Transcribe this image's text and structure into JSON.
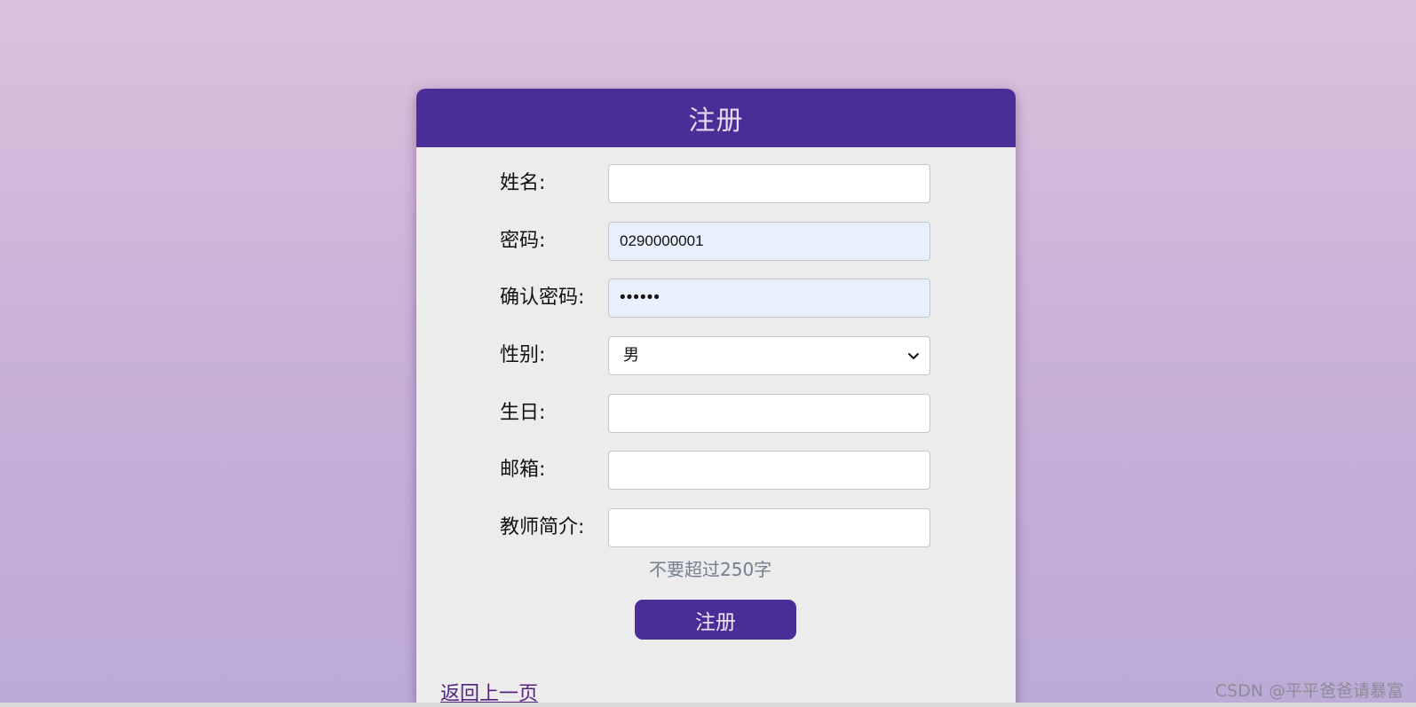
{
  "form": {
    "title": "注册",
    "fields": {
      "name": {
        "label": "姓名:",
        "value": ""
      },
      "password": {
        "label": "密码:",
        "value": "0290000001"
      },
      "confirm_password": {
        "label": "确认密码:",
        "value": "••••••"
      },
      "gender": {
        "label": "性别:",
        "value": "男"
      },
      "birthday": {
        "label": "生日:",
        "value": ""
      },
      "email": {
        "label": "邮箱:",
        "value": ""
      },
      "intro": {
        "label": "教师简介:",
        "value": ""
      }
    },
    "intro_hint": "不要超过250字",
    "submit_label": "注册",
    "back_link": "返回上一页"
  },
  "watermark": "CSDN @平平爸爸请暴富",
  "icons": {
    "select_arrow": "chevron-down-icon"
  },
  "colors": {
    "header": "#4b2d97",
    "button": "#4b2d97",
    "autofill_background": "#e8f0fd",
    "hint": "#737f8e"
  }
}
